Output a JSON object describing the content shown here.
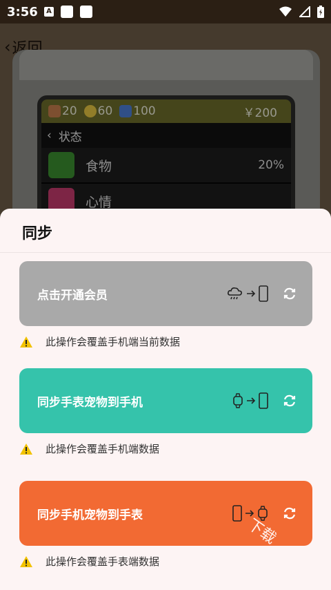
{
  "statusbar": {
    "time": "3:56",
    "app_icon_letter": "A"
  },
  "background_app": {
    "back_label": "返回",
    "stats": {
      "food": "20",
      "mood": "60",
      "health": "100",
      "money": "￥200"
    },
    "submenu_title": "状态",
    "rows": [
      {
        "label": "食物",
        "value": "20%"
      },
      {
        "label": "心情",
        "value": ""
      }
    ]
  },
  "sheet": {
    "title": "同步",
    "actions": [
      {
        "label": "点击开通会员",
        "color": "#a9a9a9",
        "direction": "cloud-to-phone",
        "warning": "此操作会覆盖手机端当前数据"
      },
      {
        "label": "同步手表宠物到手机",
        "color": "#35c3ab",
        "direction": "watch-to-phone",
        "warning": "此操作会覆盖手机端数据"
      },
      {
        "label": "同步手机宠物到手表",
        "color": "#f26a33",
        "direction": "phone-to-watch",
        "warning": "此操作会覆盖手表端数据"
      }
    ]
  },
  "watermark": "下载"
}
